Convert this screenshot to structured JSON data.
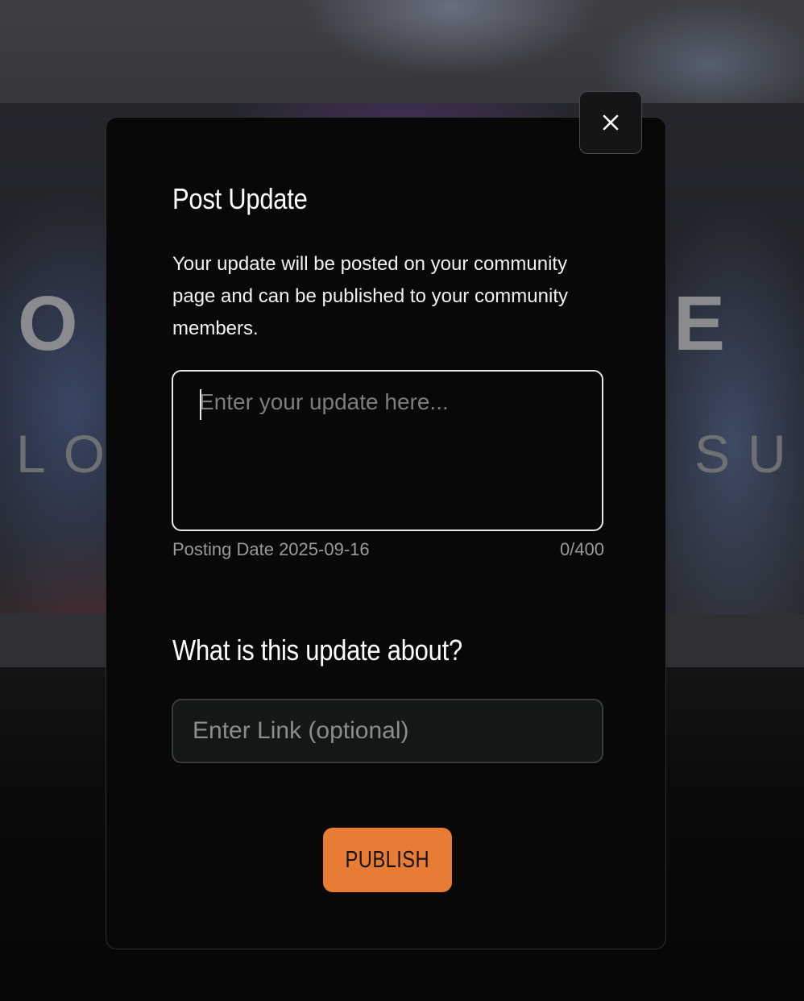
{
  "background": {
    "hero_big_left": "O",
    "hero_big_right": "E",
    "hero_small_left": "LO",
    "hero_small_right": "SU"
  },
  "modal": {
    "close_icon": "close-icon",
    "title": "Post Update",
    "description": "Your update will be posted on your community page and can be published to your community members.",
    "update_field": {
      "value": "",
      "placeholder": "Enter your update here..."
    },
    "posting_date": "Posting Date 2025-09-16",
    "char_count": "0/400",
    "topic_heading": "What is this update about?",
    "link_field": {
      "value": "",
      "placeholder": "Enter Link (optional)"
    },
    "publish_label": "PUBLISH",
    "colors": {
      "accent": "#e87c35",
      "modal_bg": "#080808",
      "input_bg": "#141718"
    }
  }
}
